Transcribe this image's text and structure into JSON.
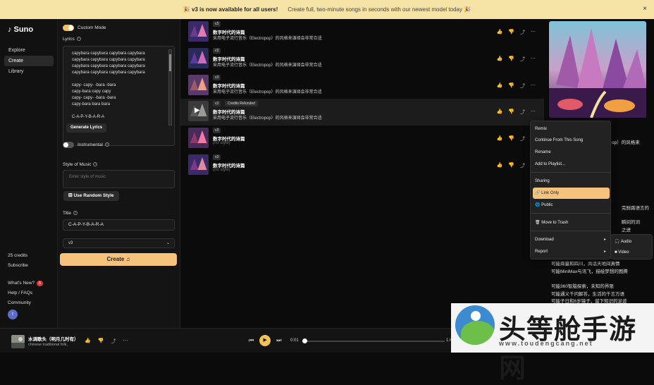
{
  "banner": {
    "headline": "🎉 v3 is now available for all users!",
    "text": "Create full, two-minute songs in seconds with our newest model today 🎉",
    "close_icon": "×"
  },
  "nav": {
    "logo": "♪ Suno",
    "items": [
      {
        "label": "Explore"
      },
      {
        "label": "Create"
      },
      {
        "label": "Library"
      }
    ],
    "credits": "25 credits",
    "subscribe": "Subscribe",
    "whats_new": "What's New?",
    "whats_new_badge": "5",
    "help": "Help / FAQs",
    "community": "Community",
    "avatar": "I"
  },
  "form": {
    "custom_mode": "Custom Mode",
    "lyrics_label": "Lyrics",
    "lyrics_lines_a": [
      "capybara capybara capybara capybara",
      "capybara capybara capybara capybara",
      "capybara capybara capybara capybara",
      "capybara capybara capybara capybara"
    ],
    "lyrics_lines_b": [
      "capy- capy- -bara -bara",
      "capy-bara capy capy",
      "capy- capy- -bara -bara",
      "capy-bara bara bara"
    ],
    "lyrics_line_c": "C-A-P-Y-B-A-R-A",
    "generate_lyrics": "Generate Lyrics",
    "instrumental": "Instrumental",
    "style_label": "Style of Music",
    "style_placeholder": "Enter style of music",
    "random_style": "Use Random Style",
    "title_label": "Title",
    "title_value": "C-A-P-Y-B-A-R-A",
    "version": "v3",
    "create": "Create ♫"
  },
  "songs": [
    {
      "tag": "v3",
      "title": "数字时代的诗篇",
      "desc": "采用电子流行音乐（Electropop）的风格来演绎会非常合适"
    },
    {
      "tag": "v3",
      "title": "数字时代的诗篇",
      "desc": "采用电子流行音乐（Electropop）的风格来演绎会非常合适"
    },
    {
      "tag": "v3",
      "title": "数字时代的诗篇",
      "desc": "采用电子流行音乐（Electropop）的风格来演绎会非常合适"
    },
    {
      "tag": "v3",
      "tag2": "Credits Refunded",
      "title": "数字时代的诗篇",
      "desc": "采用电子流行音乐（Electropop）的风格来演绎会非常合适"
    },
    {
      "tag": "v3",
      "title": "数字时代的诗篇",
      "desc": "(no style)"
    },
    {
      "tag": "v3",
      "title": "数字时代的诗篇",
      "desc": "(no style)"
    }
  ],
  "row_actions": {
    "like_icon": "👍",
    "dislike_icon": "👎",
    "share_icon": "⤴",
    "more_icon": "⋯"
  },
  "context_menu": {
    "remix": "Remix",
    "continue": "Continue From This Song",
    "rename": "Rename",
    "add_to_playlist": "Add to Playlist...",
    "sharing": "Sharing",
    "link_only": "Link Only",
    "public": "Public",
    "trash": "Move to Trash",
    "download": "Download",
    "report": "Report",
    "sub_audio": "Audio",
    "sub_video": "Video"
  },
  "side": {
    "lines": [
      "op）的风格来",
      "",
      "",
      "",
      "",
      "",
      "",
      "",
      "",
      "完鲜路语言的",
      "",
      "瞬间的词",
      "之进",
      "",
      "",
      "",
      "",
      "可能商量和四川，共话天地间真情",
      "可能MiniMax与讯飞，描绘梦想的图腾",
      "",
      "可能360智脑探索，未知的界限",
      "可能通义千问解答，生活的千言万语",
      "可能子日和6岁镜子，留下知识的足迹"
    ]
  },
  "player": {
    "title": "水调歌头（明月几时有）",
    "subtitle": "chinese traditional folk,",
    "time": "0:01",
    "end": "1:4",
    "prev_icon": "⏮",
    "play_icon": "▶",
    "next_icon": "⏭"
  },
  "watermark": {
    "title": "头等舱手游网",
    "url": "www.toudengcang.net"
  }
}
